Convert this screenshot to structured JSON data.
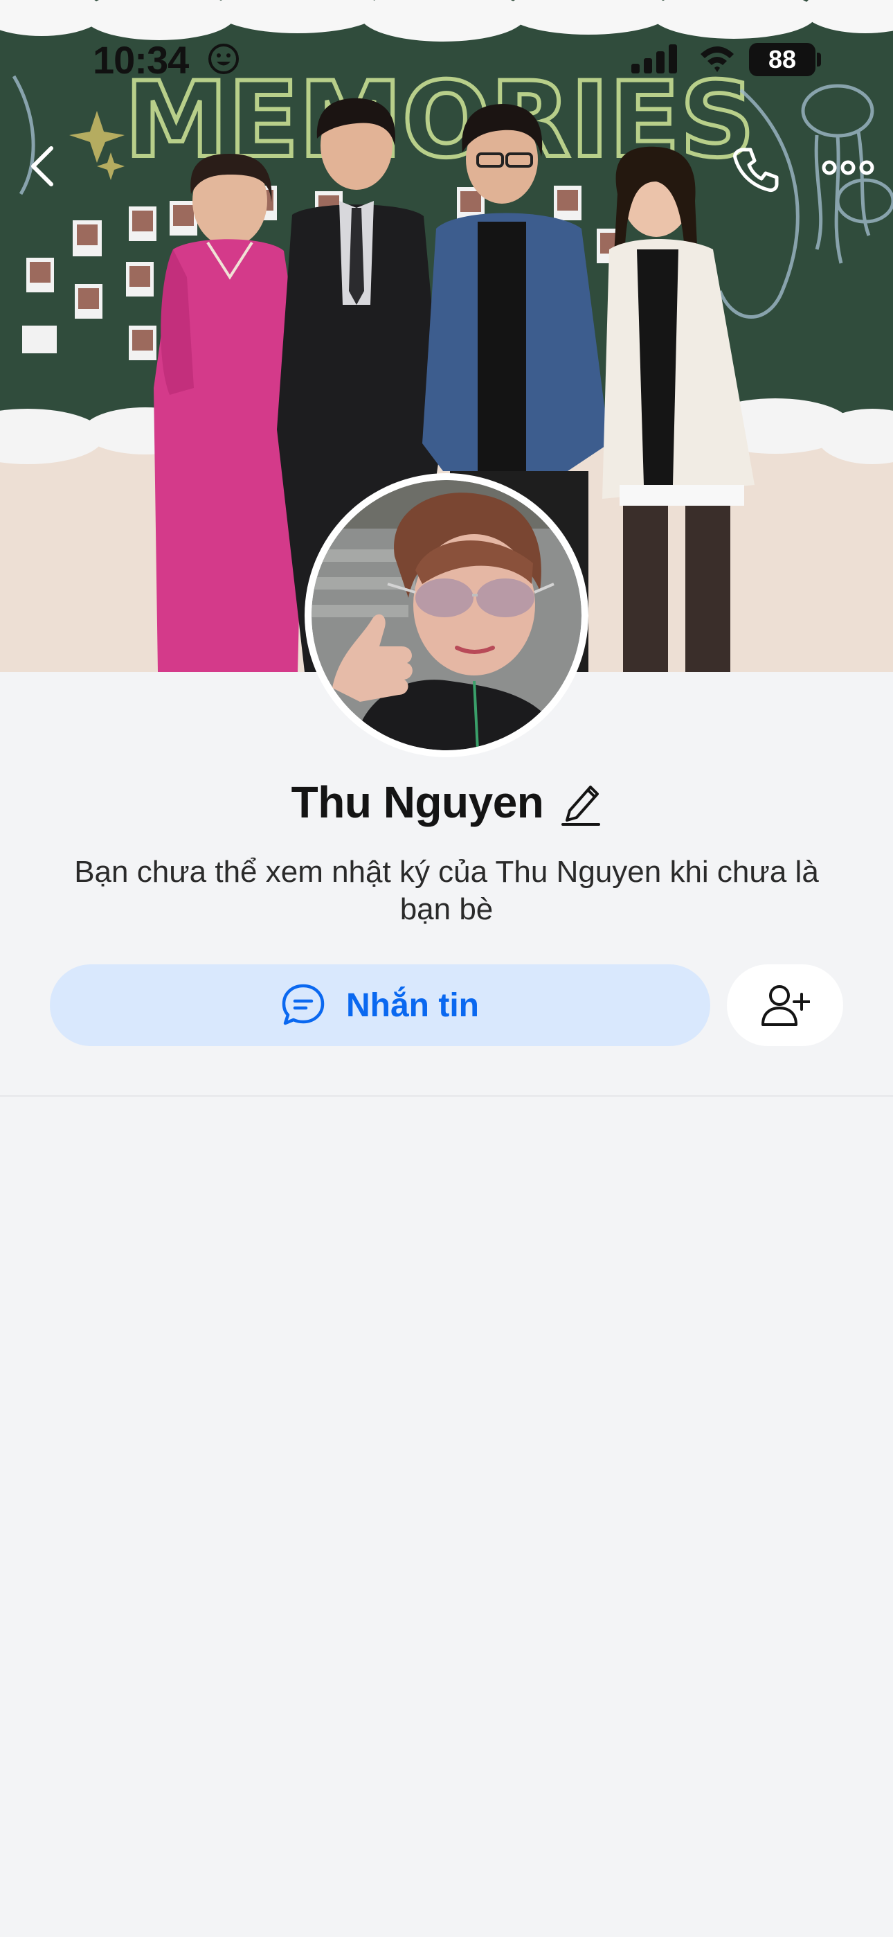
{
  "status_bar": {
    "time": "10:34",
    "battery": "88",
    "icons": [
      "smiley-face-icon",
      "cellular-signal-icon",
      "wifi-icon",
      "battery-icon"
    ]
  },
  "nav": {
    "back_icon": "chevron-left-icon",
    "call_icon": "phone-icon",
    "more_icon": "more-dots-icon"
  },
  "cover": {
    "banner_text": "MEMORIES"
  },
  "profile": {
    "name": "Thu Nguyen",
    "edit_icon": "pencil-icon",
    "notice": "Bạn chưa thể xem nhật ký của Thu Nguyen khi chưa là bạn bè"
  },
  "actions": {
    "message_label": "Nhắn tin",
    "message_icon": "chat-bubble-icon",
    "add_friend_icon": "add-friend-icon"
  },
  "colors": {
    "accent": "#0a68f0",
    "message_bg": "#d9e8fd",
    "page_bg": "#f3f4f6",
    "text": "#141414"
  }
}
